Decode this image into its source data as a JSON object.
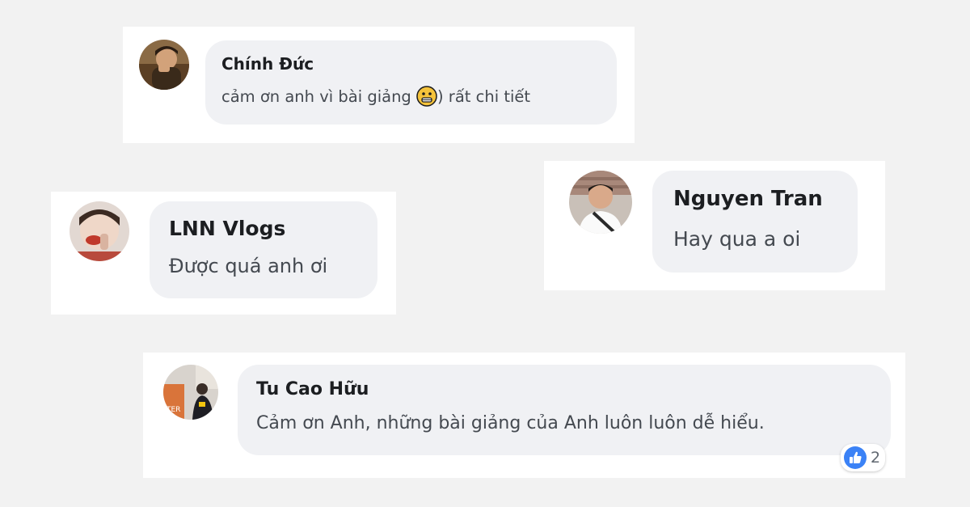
{
  "comments": [
    {
      "author": "Chính Đức",
      "text_before": "cảm ơn anh vì bài giảng ",
      "emoji": "grinning-face-emoji",
      "text_after": ") rất chi tiết"
    },
    {
      "author": "Nguyen Tran",
      "text": "Hay qua a oi"
    },
    {
      "author": "LNN Vlogs",
      "text": "Được quá anh ơi"
    },
    {
      "author": "Tu Cao Hữu",
      "text": "Cảm ơn Anh, những bài giảng của Anh luôn luôn dễ hiểu.",
      "reaction": {
        "icon": "like-icon",
        "count": "2",
        "color": "#3b82f6"
      }
    }
  ],
  "colors": {
    "background": "#f2f2f2",
    "card": "#ffffff",
    "bubble": "#f0f1f4",
    "author": "#1c1e21",
    "text": "#444950",
    "like_blue": "#3b82f6"
  }
}
